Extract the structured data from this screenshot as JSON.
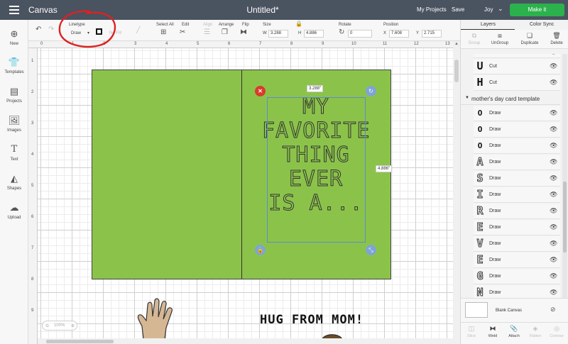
{
  "app": {
    "title": "Canvas",
    "document_title": "Untitled*"
  },
  "header": {
    "my_projects": "My Projects",
    "save": "Save",
    "user": "Joy",
    "make_it": "Make it"
  },
  "toolbar": {
    "linetype_label": "Linetype",
    "linetype_value": "Draw",
    "fill_value": "No Fill",
    "select_all": "Select All",
    "edit": "Edit",
    "align": "Align",
    "arrange": "Arrange",
    "flip": "Flip",
    "size": "Size",
    "size_w_label": "W",
    "size_w": "3.288",
    "size_h_label": "H",
    "size_h": "4.886",
    "rotate": "Rotate",
    "rotate_value": "0",
    "position": "Position",
    "position_x_label": "X",
    "position_x": "7.608",
    "position_y_label": "Y",
    "position_y": "2.715"
  },
  "ruler": {
    "top": [
      "0",
      "1",
      "2",
      "3",
      "4",
      "5",
      "6",
      "7",
      "8",
      "9",
      "10",
      "11",
      "12",
      "13"
    ],
    "left": [
      "1",
      "2",
      "3",
      "4",
      "5",
      "6",
      "7",
      "8",
      "9"
    ]
  },
  "sidebar": {
    "items": [
      {
        "label": "New"
      },
      {
        "label": "Templates"
      },
      {
        "label": "Projects"
      },
      {
        "label": "Images"
      },
      {
        "label": "Text"
      },
      {
        "label": "Shapes"
      },
      {
        "label": "Upload"
      }
    ]
  },
  "right_panel": {
    "tabs": [
      "Layers",
      "Color Sync"
    ],
    "actions": [
      "Group",
      "UnGroup",
      "Duplicate",
      "Delete"
    ],
    "top_layers": [
      {
        "glyph": "U",
        "name": "Cut"
      },
      {
        "glyph": "H",
        "name": "Cut"
      }
    ],
    "group_name": "mother's day card template",
    "group_layers": [
      {
        "glyph": "O",
        "name": "Draw"
      },
      {
        "glyph": "O",
        "name": "Draw"
      },
      {
        "glyph": "O",
        "name": "Draw"
      },
      {
        "glyph": "A",
        "name": "Draw"
      },
      {
        "glyph": "S",
        "name": "Draw"
      },
      {
        "glyph": "I",
        "name": "Draw"
      },
      {
        "glyph": "R",
        "name": "Draw"
      },
      {
        "glyph": "E",
        "name": "Draw"
      },
      {
        "glyph": "V",
        "name": "Draw"
      },
      {
        "glyph": "E",
        "name": "Draw"
      },
      {
        "glyph": "G",
        "name": "Draw"
      },
      {
        "glyph": "N",
        "name": "Draw"
      }
    ],
    "blank_canvas": "Blank Canvas",
    "bottom_actions": [
      "Slice",
      "Weld",
      "Attach",
      "Flatten",
      "Contour"
    ]
  },
  "canvas": {
    "card_lines": [
      "MY",
      "FAVORITE",
      "THING",
      "EVER",
      "IS A..."
    ],
    "width_label": "3.288\"",
    "height_label": "4.886\"",
    "hug_text": "HUG FROM MOM!",
    "zoom": "100%",
    "colors": {
      "card": "#8bc34a",
      "selection": "#5b8bd6",
      "annotation": "#e02020"
    }
  }
}
